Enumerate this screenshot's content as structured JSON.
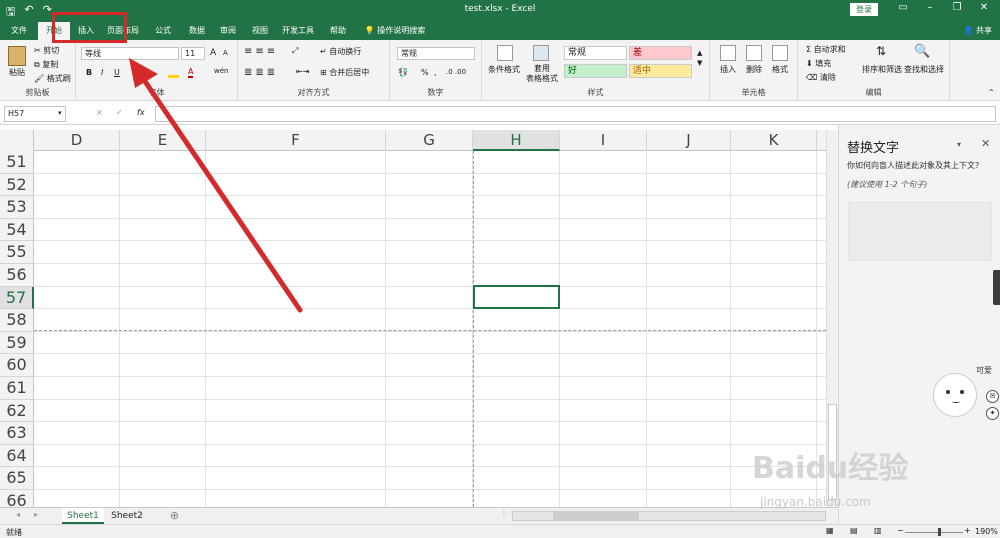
{
  "titlebar": {
    "doc_title": "test.xlsx - Excel",
    "login": "登录",
    "share": "共享"
  },
  "tabs": [
    "文件",
    "开始",
    "插入",
    "页面布局",
    "公式",
    "数据",
    "审阅",
    "视图",
    "开发工具",
    "帮助",
    "操作说明搜索"
  ],
  "ribbon": {
    "clipboard": {
      "label": "剪贴板",
      "paste": "粘贴",
      "cut": "剪切",
      "copy": "复制",
      "format_painter": "格式刷"
    },
    "font": {
      "label": "字体",
      "font_name": "等线",
      "font_size": "11",
      "grow": "A",
      "shrink": "A",
      "bold": "B",
      "italic": "I",
      "underline": "U",
      "font_color": "A",
      "phonetic": "wén"
    },
    "alignment": {
      "label": "对齐方式",
      "wrap": "自动换行",
      "merge": "合并后居中"
    },
    "number": {
      "label": "数字",
      "format": "常规",
      "percent": "%",
      "comma": ","
    },
    "styles": {
      "label": "样式",
      "conditional": "条件格式",
      "table_format": "套用\n表格格式",
      "normal": "常规",
      "bad": "差",
      "good": "好",
      "neutral": "适中"
    },
    "cells": {
      "label": "单元格",
      "insert": "插入",
      "delete": "删除",
      "format": "格式"
    },
    "editing": {
      "label": "编辑",
      "autosum": "自动求和",
      "fill": "填充",
      "clear": "清除",
      "sort": "排序和筛选",
      "find": "查找和选择"
    }
  },
  "formula": {
    "name_box": "H57",
    "cancel": "×",
    "enter": "✓",
    "fx": "fx"
  },
  "columns": [
    "D",
    "E",
    "F",
    "G",
    "H",
    "I",
    "J",
    "K"
  ],
  "rows": [
    "51",
    "52",
    "53",
    "54",
    "55",
    "56",
    "57",
    "58",
    "59",
    "60",
    "61",
    "62",
    "63",
    "64",
    "65",
    "66"
  ],
  "selected": {
    "col": "H",
    "row": "57"
  },
  "sheets": [
    "Sheet1",
    "Sheet2"
  ],
  "status": {
    "mode": "就绪",
    "zoom": "190%"
  },
  "pane": {
    "title": "替换文字",
    "question": "你如何向盲人描述此对象及其上下文?",
    "hint": "(建议使用 1-2 个句子)",
    "sticker_text": "可爱"
  },
  "watermark": {
    "brand": "Baidu经验",
    "url": "jingyan.baidu.com"
  },
  "colors": {
    "excel_green": "#217346",
    "annotation_red": "#d42a2a",
    "bad_fill": "#ffc7ce",
    "good_fill": "#c6efce",
    "neutral_fill": "#ffeb9c"
  }
}
